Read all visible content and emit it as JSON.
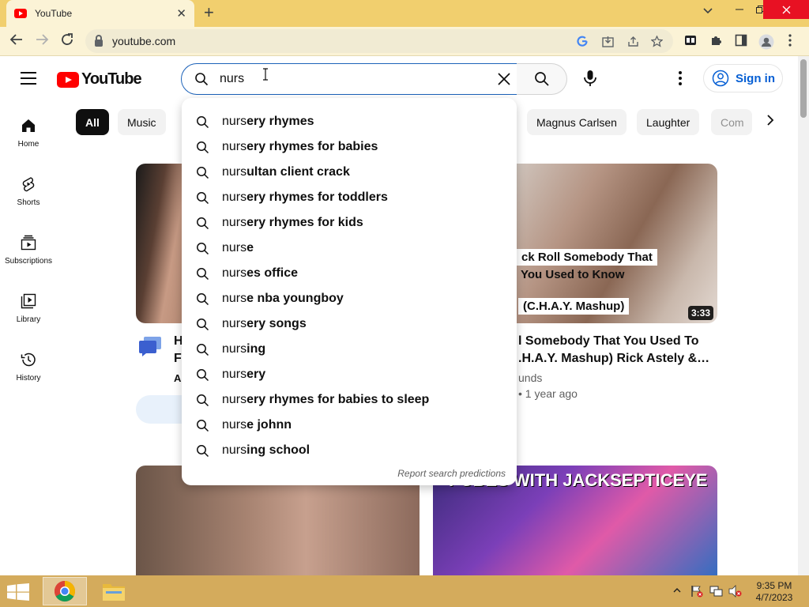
{
  "browser": {
    "tab_title": "YouTube",
    "tab_close": "✕",
    "new_tab": "+",
    "url": "youtube.com"
  },
  "header": {
    "logo_text": "YouTube",
    "search_value": "nurs",
    "signin_label": "Sign in"
  },
  "sidebar": {
    "items": [
      {
        "label": "Home",
        "icon": "home-icon"
      },
      {
        "label": "Shorts",
        "icon": "shorts-icon"
      },
      {
        "label": "Subscriptions",
        "icon": "subscriptions-icon"
      },
      {
        "label": "Library",
        "icon": "library-icon"
      },
      {
        "label": "History",
        "icon": "history-icon"
      }
    ]
  },
  "chips": {
    "all": "All",
    "music": "Music",
    "magnus": "Magnus Carlsen",
    "laughter": "Laughter",
    "partial": "Com"
  },
  "suggestions": {
    "typed": "nurs",
    "items": [
      {
        "rest": "ery rhymes"
      },
      {
        "rest": "ery rhymes for babies"
      },
      {
        "rest": "ultan client crack"
      },
      {
        "rest": "ery rhymes for toddlers"
      },
      {
        "rest": "ery rhymes for kids"
      },
      {
        "rest": "e"
      },
      {
        "rest": "es office"
      },
      {
        "rest": "e nba youngboy"
      },
      {
        "rest": "ery songs"
      },
      {
        "rest": "ing"
      },
      {
        "rest": "ery"
      },
      {
        "rest": "ery rhymes for babies to sleep"
      },
      {
        "rest": "e johnn"
      },
      {
        "rest": "ing school"
      }
    ],
    "report": "Report search predictions"
  },
  "videos": {
    "v1": {
      "title_line1": "H",
      "title_line2": "F",
      "channel": "A"
    },
    "v2": {
      "caption1": "ck Roll Somebody That",
      "caption2": "You Used to Know",
      "caption3": "(C.H.A.Y. Mashup)",
      "duration": "3:33",
      "title_line1": "l Somebody That You Used To",
      "title_line2": ".H.A.Y. Mashup) Rick Astely &…",
      "channel": "unds",
      "meta": "• 1 year ago"
    },
    "v4": {
      "caption": "PUBES WITH JACKSEPTICEYE"
    }
  },
  "taskbar": {
    "time": "9:35 PM",
    "date": "4/7/2023"
  },
  "colors": {
    "tabstrip": "#f1cf6e",
    "toolbar": "#fbf3d6",
    "taskbar": "#d4ab5c",
    "yt_red": "#ff0000",
    "link_blue": "#065fd4"
  }
}
